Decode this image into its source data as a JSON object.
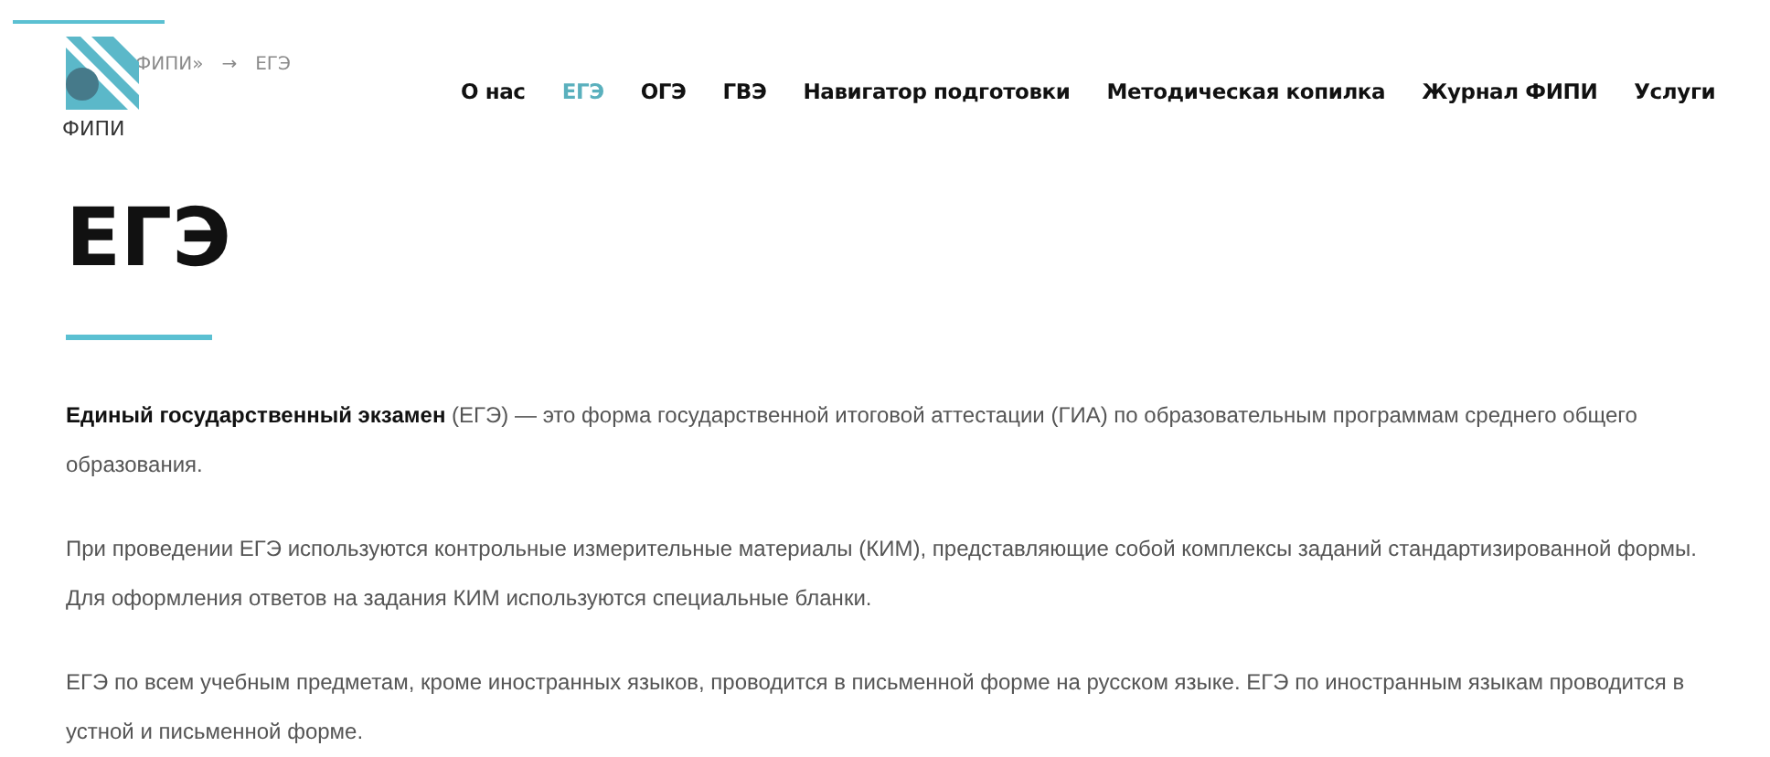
{
  "logo": {
    "caption": "ФИПИ"
  },
  "breadcrumb": {
    "items": [
      "ФИПИ»",
      "ЕГЭ"
    ],
    "separator": "→"
  },
  "nav": [
    {
      "label": "О нас",
      "selected": false
    },
    {
      "label": "ЕГЭ",
      "selected": true
    },
    {
      "label": "ОГЭ",
      "selected": false
    },
    {
      "label": "ГВЭ",
      "selected": false
    },
    {
      "label": "Навигатор подготовки",
      "selected": false
    },
    {
      "label": "Методическая копилка",
      "selected": false
    },
    {
      "label": "Журнал ФИПИ",
      "selected": false
    },
    {
      "label": "Услуги",
      "selected": false
    }
  ],
  "title": "ЕГЭ",
  "paragraphs": [
    "**Единый государственный экзамен** (ЕГЭ) — это форма государственной итоговой аттестации (ГИА) по образовательным программам среднего общего образования.",
    "При проведении ЕГЭ используются контрольные измерительные материалы (КИМ), представляющие собой комплексы заданий стандартизированной формы. Для оформления ответов на задания КИМ используются специальные бланки.",
    "ЕГЭ по всем учебным предметам, кроме иностранных языков, проводится в письменной форме на русском языке. ЕГЭ по иностранным языкам проводится в устной и письменной форме."
  ]
}
